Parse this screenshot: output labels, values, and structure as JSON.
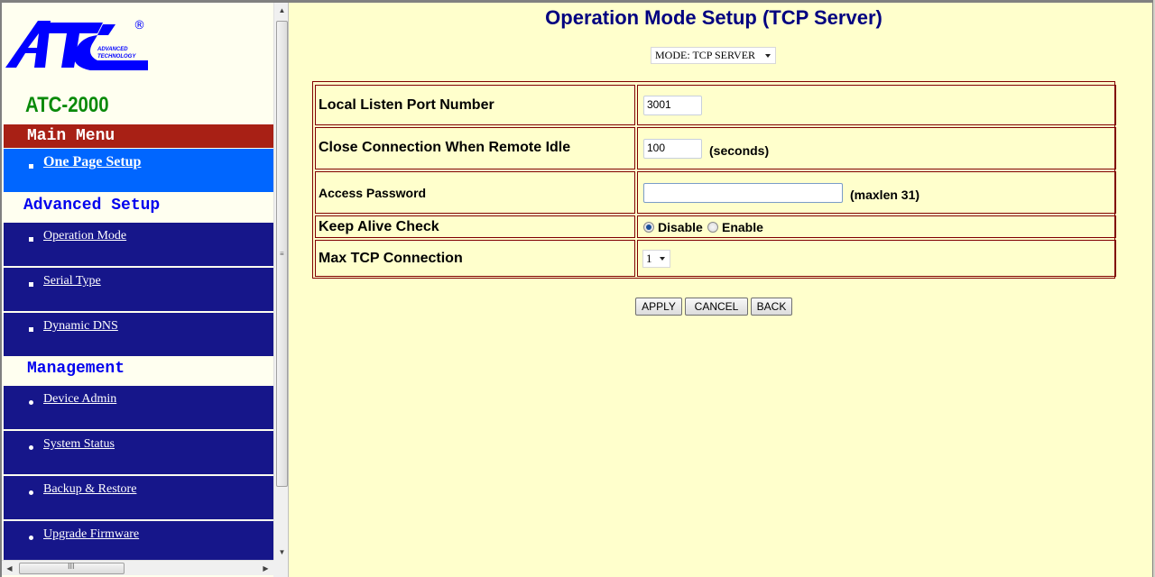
{
  "sidebar": {
    "logo": {
      "brand": "ATC",
      "tagline_1": "ADVANCED",
      "tagline_2": "TECHNOLOGY",
      "registered": "®"
    },
    "model": "ATC-2000",
    "main_menu_title": "Main Menu",
    "main_menu_items": [
      {
        "label": "One Page Setup",
        "icon": "square-bullet",
        "active": true
      }
    ],
    "advanced_title": "Advanced Setup",
    "advanced_items": [
      {
        "label": "Operation Mode",
        "icon": "square-bullet"
      },
      {
        "label": "Serial Type",
        "icon": "square-bullet"
      },
      {
        "label": "Dynamic DNS",
        "icon": "square-bullet"
      }
    ],
    "management_title": "Management",
    "management_items": [
      {
        "label": "Device Admin",
        "icon": "round-bullet"
      },
      {
        "label": "System Status",
        "icon": "round-bullet"
      },
      {
        "label": "Backup & Restore",
        "icon": "round-bullet"
      },
      {
        "label": "Upgrade Firmware",
        "icon": "round-bullet"
      }
    ],
    "scrollbar_grip_v": "≡",
    "scrollbar_grip_h": "III"
  },
  "main": {
    "title": "Operation Mode Setup (TCP Server)",
    "mode_select": {
      "value": "MODE: TCP SERVER"
    },
    "form": {
      "local_port": {
        "label": "Local Listen Port Number",
        "value": "3001"
      },
      "idle": {
        "label": "Close Connection When Remote Idle",
        "value": "100",
        "hint": "(seconds)"
      },
      "password": {
        "label": "Access Password",
        "value": "",
        "hint": "(maxlen  31)"
      },
      "keep_alive": {
        "label": "Keep Alive Check",
        "options": [
          "Disable",
          "Enable"
        ],
        "selected": "Disable"
      },
      "max_tcp": {
        "label": "Max TCP Connection",
        "value": "1"
      }
    },
    "buttons": {
      "apply": "APPLY",
      "cancel": "CANCEL",
      "back": "BACK"
    }
  },
  "colors": {
    "page_bg": "#ffffcc",
    "title": "#000080",
    "menu_header": "#a82015",
    "nav_item": "#16168a",
    "nav_active": "#0066ff",
    "section_title": "#0000ee",
    "model": "#0a8a0a",
    "table_border": "#800000",
    "logo": "#0000ff"
  }
}
